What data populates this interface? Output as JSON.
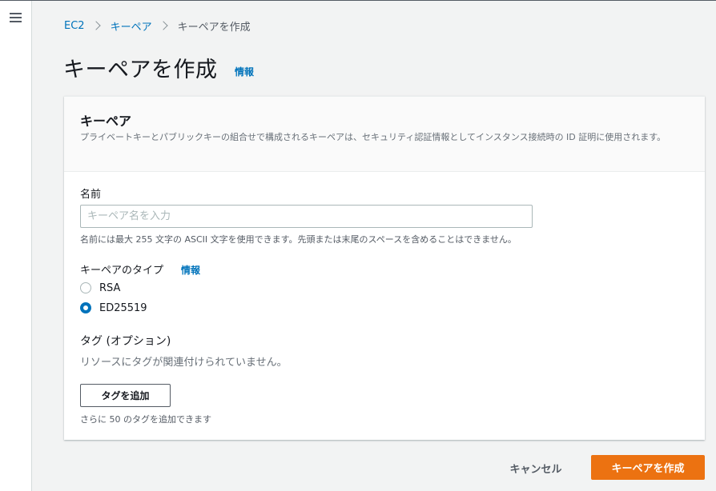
{
  "breadcrumb": {
    "items": [
      {
        "label": "EC2"
      },
      {
        "label": "キーペア"
      },
      {
        "label": "キーペアを作成"
      }
    ]
  },
  "page": {
    "title": "キーペアを作成",
    "info_link": "情報"
  },
  "panel": {
    "title": "キーペア",
    "description": "プライベートキーとパブリックキーの組合せで構成されるキーペアは、セキュリティ認証情報としてインスタンス接続時の ID 証明に使用されます。"
  },
  "name_field": {
    "label": "名前",
    "value": "",
    "placeholder": "キーペア名を入力",
    "constraint": "名前には最大 255 文字の ASCII 文字を使用できます。先頭または末尾のスペースを含めることはできません。"
  },
  "key_type": {
    "label": "キーペアのタイプ",
    "info_link": "情報",
    "options": [
      {
        "label": "RSA",
        "selected": false
      },
      {
        "label": "ED25519",
        "selected": true
      }
    ]
  },
  "tags": {
    "label": "タグ (オプション)",
    "empty_text": "リソースにタグが関連付けられていません。",
    "add_button": "タグを追加",
    "hint": "さらに 50 のタグを追加できます"
  },
  "actions": {
    "cancel": "キャンセル",
    "create": "キーペアを作成"
  },
  "colors": {
    "accent": "#0073bb",
    "primary_button": "#ec7211"
  }
}
